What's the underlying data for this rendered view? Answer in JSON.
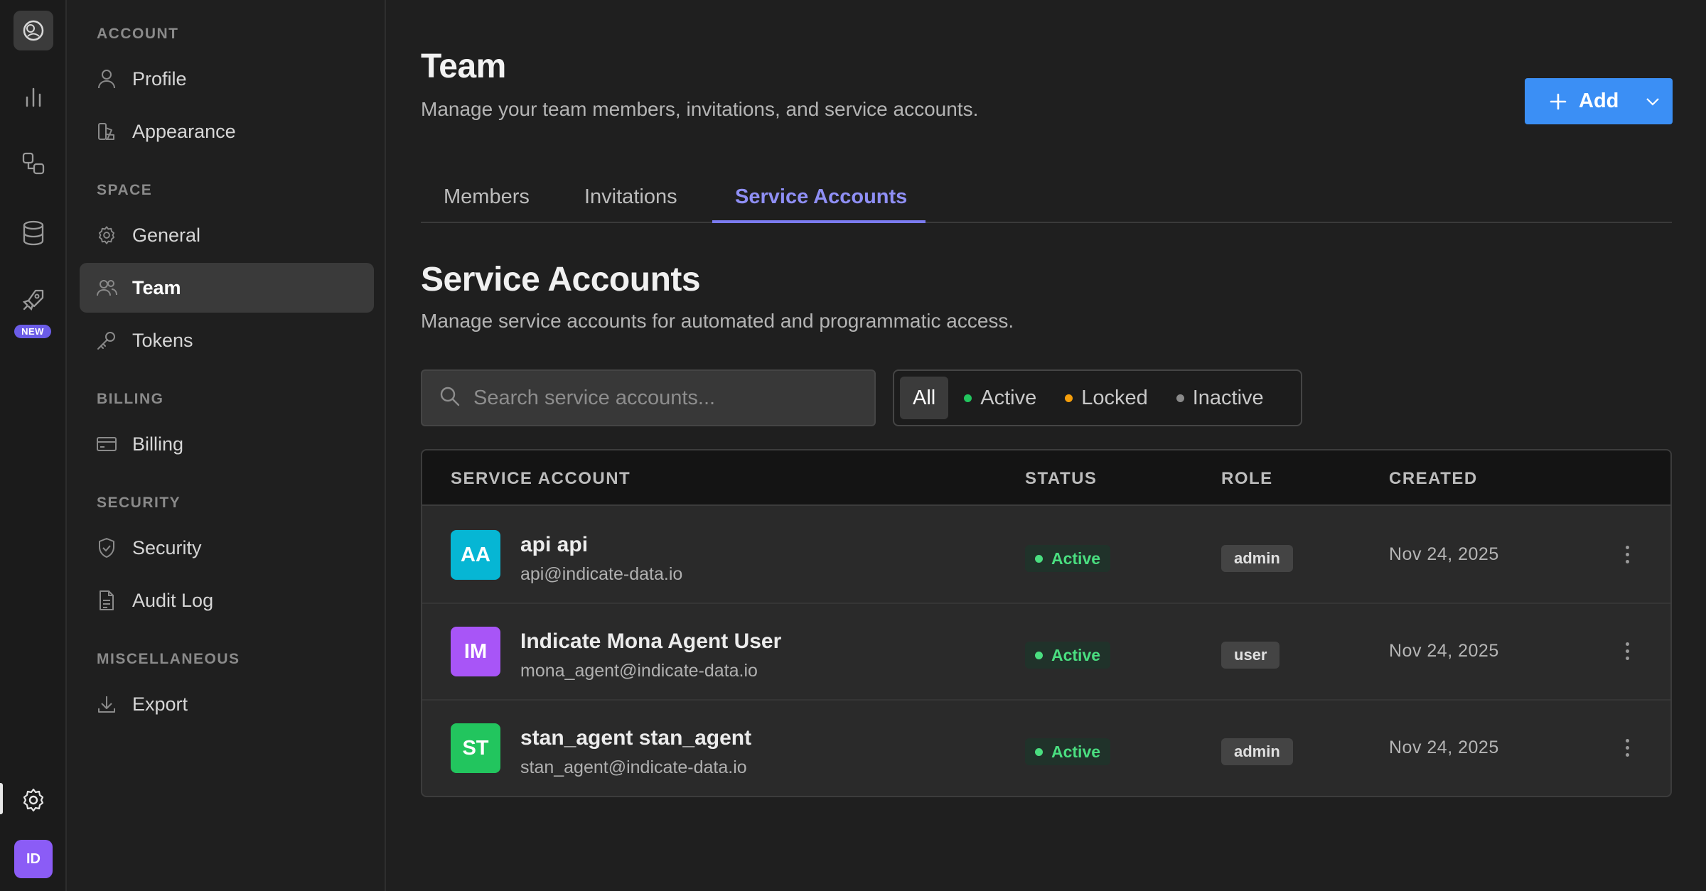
{
  "rail": {
    "new_badge": "NEW",
    "avatar_initials": "ID",
    "icons": [
      "app-logo-icon",
      "analytics-icon",
      "flow-icon",
      "database-icon",
      "rocket-icon",
      "settings-icon"
    ]
  },
  "sidebar": {
    "sections": [
      {
        "title": "ACCOUNT",
        "items": [
          {
            "label": "Profile",
            "icon": "user-icon"
          },
          {
            "label": "Appearance",
            "icon": "palette-icon"
          }
        ]
      },
      {
        "title": "SPACE",
        "items": [
          {
            "label": "General",
            "icon": "gear-icon"
          },
          {
            "label": "Team",
            "icon": "users-icon"
          },
          {
            "label": "Tokens",
            "icon": "key-icon"
          }
        ]
      },
      {
        "title": "BILLING",
        "items": [
          {
            "label": "Billing",
            "icon": "credit-card-icon"
          }
        ]
      },
      {
        "title": "SECURITY",
        "items": [
          {
            "label": "Security",
            "icon": "shield-icon"
          },
          {
            "label": "Audit Log",
            "icon": "document-icon"
          }
        ]
      },
      {
        "title": "MISCELLANEOUS",
        "items": [
          {
            "label": "Export",
            "icon": "download-icon"
          }
        ]
      }
    ],
    "active_item": "Team"
  },
  "header": {
    "title": "Team",
    "subtitle": "Manage your team members, invitations, and service accounts.",
    "add_label": "Add"
  },
  "tabs": [
    {
      "label": "Members"
    },
    {
      "label": "Invitations"
    },
    {
      "label": "Service Accounts"
    }
  ],
  "active_tab": "Service Accounts",
  "section": {
    "title": "Service Accounts",
    "subtitle": "Manage service accounts for automated and programmatic access."
  },
  "search": {
    "placeholder": "Search service accounts...",
    "value": ""
  },
  "filters": [
    {
      "label": "All",
      "active": true,
      "dot": ""
    },
    {
      "label": "Active",
      "active": false,
      "dot": "#22c55e"
    },
    {
      "label": "Locked",
      "active": false,
      "dot": "#f59e0b"
    },
    {
      "label": "Inactive",
      "active": false,
      "dot": "#8a8a8a"
    }
  ],
  "table": {
    "columns": [
      "SERVICE ACCOUNT",
      "STATUS",
      "ROLE",
      "CREATED"
    ],
    "rows": [
      {
        "initials": "AA",
        "avatar_color": "#06b6d4",
        "name": "api api",
        "email": "api@indicate-data.io",
        "status": "Active",
        "role": "admin",
        "created": "Nov 24, 2025"
      },
      {
        "initials": "IM",
        "avatar_color": "#a855f7",
        "name": "Indicate Mona Agent User",
        "email": "mona_agent@indicate-data.io",
        "status": "Active",
        "role": "user",
        "created": "Nov 24, 2025"
      },
      {
        "initials": "ST",
        "avatar_color": "#22c55e",
        "name": "stan_agent stan_agent",
        "email": "stan_agent@indicate-data.io",
        "status": "Active",
        "role": "admin",
        "created": "Nov 24, 2025"
      }
    ]
  },
  "colors": {
    "accent": "#3b8ff5",
    "tab_active": "#8f8ff5",
    "status_active": "#4ade80"
  }
}
